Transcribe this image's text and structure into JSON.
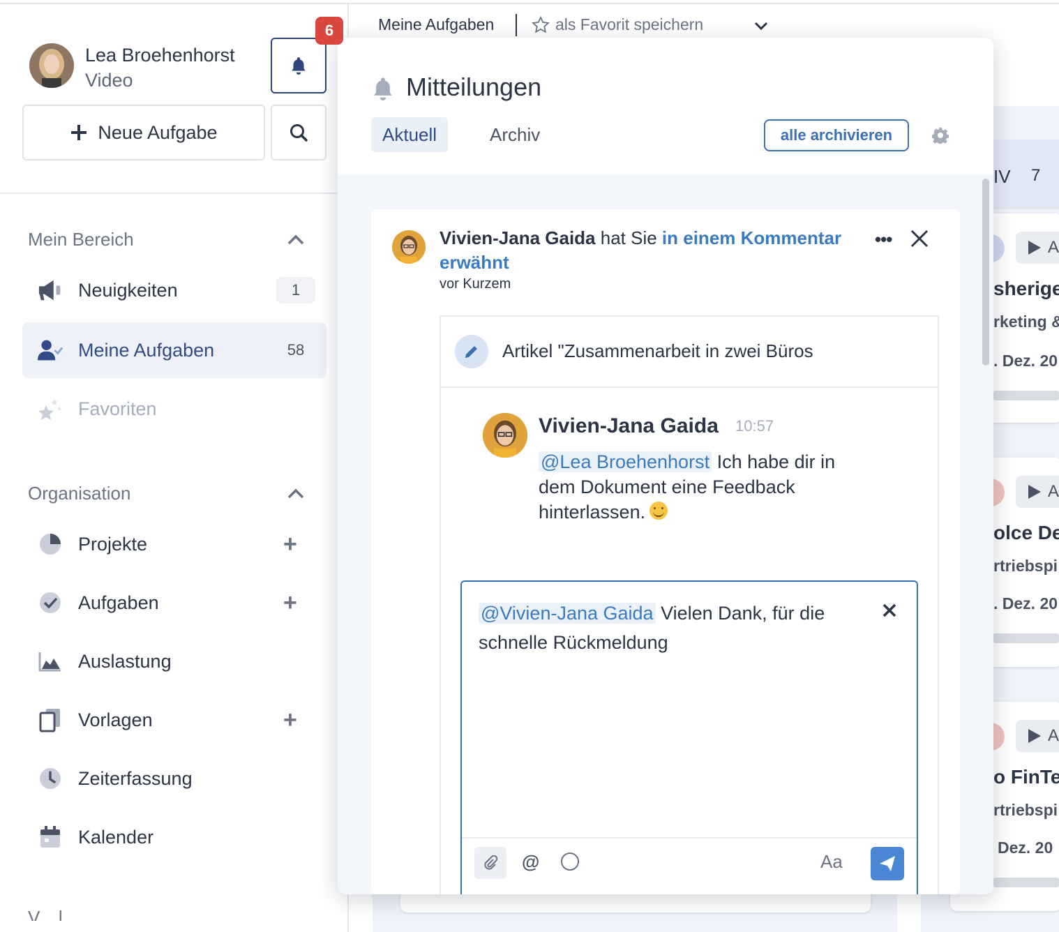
{
  "user": {
    "name": "Lea Broehenhorst",
    "subtitle": "Video"
  },
  "notifications_badge": "6",
  "sidebar": {
    "new_task_label": "Neue Aufgabe",
    "section_my": "Mein Bereich",
    "section_org": "Organisation",
    "section_bottom_partial": "V... l...",
    "my_items": [
      {
        "label": "Neuigkeiten",
        "count": "1",
        "icon": "megaphone-icon"
      },
      {
        "label": "Meine Aufgaben",
        "count": "58",
        "icon": "user-check-icon"
      },
      {
        "label": "Favoriten",
        "icon": "stars-icon"
      }
    ],
    "org_items": [
      {
        "label": "Projekte",
        "icon": "pie-chart-icon"
      },
      {
        "label": "Aufgaben",
        "icon": "check-circle-icon"
      },
      {
        "label": "Auslastung",
        "icon": "area-chart-icon"
      },
      {
        "label": "Vorlagen",
        "icon": "documents-icon"
      },
      {
        "label": "Zeiterfassung",
        "icon": "clock-icon"
      },
      {
        "label": "Kalender",
        "icon": "calendar-icon"
      }
    ]
  },
  "header": {
    "breadcrumb": "Meine Aufgaben",
    "favorite_label": "als Favorit speichern"
  },
  "board": {
    "col_label": "IV",
    "col_count": "7",
    "cards": [
      {
        "title": "sherige",
        "sub": "rketing &",
        "date": ". Dez. 20"
      },
      {
        "title": "olce De",
        "sub": "rtriebspi",
        "date": ". Dez. 20"
      },
      {
        "title": "o FinTe",
        "sub": "rtriebspi",
        "date": "Dez. 20"
      }
    ],
    "chip_letter": "A"
  },
  "popover": {
    "title": "Mitteilungen",
    "tab_current": "Aktuell",
    "tab_archive": "Archiv",
    "archive_all": "alle archivieren",
    "notification": {
      "actor": "Vivien-Jana Gaida",
      "text_mid": " hat Sie ",
      "link_text": "in einem Kommentar erwähnt",
      "time": "vor Kurzem",
      "task_title": "Artikel \"Zusammenarbeit in zwei Büros",
      "comment": {
        "author": "Vivien-Jana Gaida",
        "time": "10:57",
        "mention": "@Lea Broehenhorst",
        "text": " Ich habe dir in dem Dokument eine Feedback hinterlassen."
      },
      "reply": {
        "mention": "@Vivien-Jana Gaida",
        "text": " Vielen Dank, für die schnelle Rückmeldung",
        "format_label": "Aa"
      }
    }
  }
}
